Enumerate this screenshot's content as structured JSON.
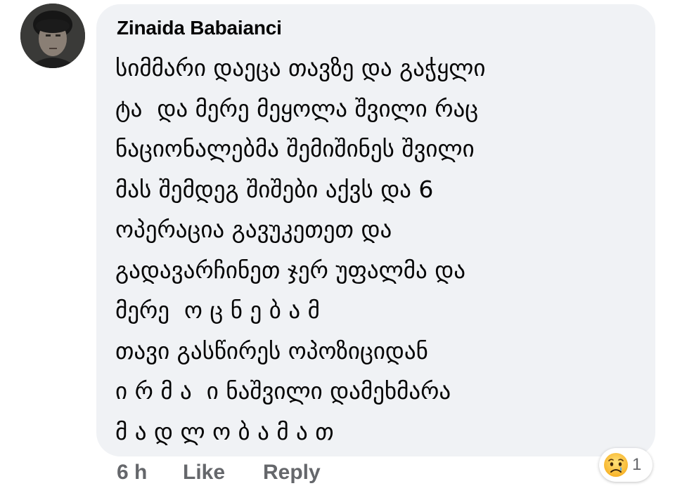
{
  "comment": {
    "author": "Zinaida Babaianci",
    "lines": [
      "სიმმარი დაეცა თავზე და გაჭყლი",
      "ტა  და მერე მეყოლა შვილი რაც",
      "ნაციონალებმა შემიშინეს შვილი",
      "მას შემდეგ შიშები აქვს და 6",
      "ოპერაცია გავუკეთეთ და",
      "გადავარჩინეთ ჯერ უფალმა და",
      "მერე  ო ც ნ ე ბ ა მ",
      "თავი გასწირეს ოპოზიციდან",
      "ი რ მ ა  ი ნაშვილი დამეხმარა",
      "მ ა დ ლ ო ბ ა მ ა თ"
    ],
    "time": "6 h",
    "like_label": "Like",
    "reply_label": "Reply",
    "reactions": {
      "icon": "sad-reaction-icon",
      "count": "1"
    }
  },
  "colors": {
    "bubble": "#f0f2f5",
    "text": "#050505",
    "meta": "#65676b"
  }
}
